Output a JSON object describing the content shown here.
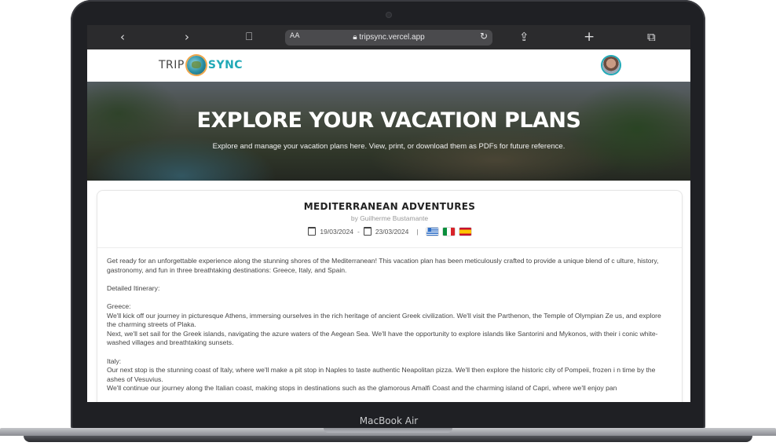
{
  "device": {
    "label": "MacBook Air"
  },
  "browser": {
    "text_size_label": "AA",
    "url": "tripsync.vercel.app",
    "icons": [
      "back-icon",
      "forward-icon",
      "bookmarks-icon",
      "lock-icon",
      "reload-icon",
      "share-icon",
      "new-tab-icon",
      "tabs-icon"
    ]
  },
  "header": {
    "logo_left": "TRIP",
    "logo_right": "SYNC"
  },
  "hero": {
    "title": "EXPLORE YOUR VACATION PLANS",
    "subtitle": "Explore and manage your vacation plans here. View, print, or download them as PDFs for future reference."
  },
  "plan": {
    "title": "MEDITERRANEAN ADVENTURES",
    "author": "by Guilherme Bustamante",
    "start_date": "19/03/2024",
    "end_date": "23/03/2024",
    "date_separator": "-",
    "meta_separator": "|",
    "flags": [
      "Greece",
      "Italy",
      "Spain"
    ],
    "description": [
      "Get ready for an unforgettable experience along the stunning shores of the Mediterranean! This vacation plan has been meticulously crafted to provide a unique blend of c ulture, history, gastronomy, and fun in three breathtaking destinations: Greece, Italy, and Spain.",
      "",
      "Detailed Itinerary:",
      "",
      "Greece:",
      "We'll kick off our journey in picturesque Athens, immersing ourselves in the rich heritage of ancient Greek civilization. We'll visit the Parthenon, the Temple of Olympian Ze us, and explore the charming streets of Plaka.",
      "Next, we'll set sail for the Greek islands, navigating the azure waters of the Aegean Sea. We'll have the opportunity to explore islands like Santorini and Mykonos, with their i conic white-washed villages and breathtaking sunsets.",
      "",
      "Italy:",
      "Our next stop is the stunning coast of Italy, where we'll make a pit stop in Naples to taste authentic Neapolitan pizza. We'll then explore the historic city of Pompeii, frozen i n time by the ashes of Vesuvius.",
      "We'll continue our journey along the Italian coast, making stops in destinations such as the glamorous Amalfi Coast and the charming island of Capri, where we'll enjoy pan"
    ]
  }
}
